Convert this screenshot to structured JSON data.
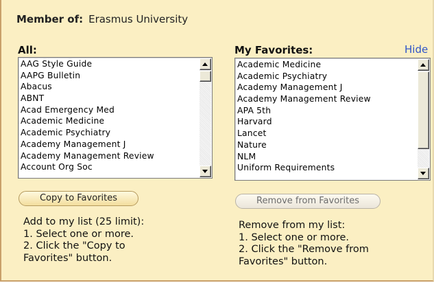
{
  "member": {
    "label": "Member of:",
    "value": "Erasmus University"
  },
  "all": {
    "title": "All:",
    "items": [
      "AAG Style Guide",
      "AAPG Bulletin",
      "Abacus",
      "ABNT",
      "Acad Emergency Med",
      "Academic Medicine",
      "Academic Psychiatry",
      "Academy Management J",
      "Academy Management Review",
      "Account Org Soc"
    ]
  },
  "favorites": {
    "title": "My Favorites:",
    "hide_label": "Hide",
    "items": [
      "Academic Medicine",
      "Academic Psychiatry",
      "Academy Management J",
      "Academy Management Review",
      "APA 5th",
      "Harvard",
      "Lancet",
      "Nature",
      "NLM",
      "Uniform Requirements"
    ]
  },
  "buttons": {
    "copy": "Copy to Favorites",
    "remove": "Remove from Favorites"
  },
  "instructions_add": [
    "Add to my list (25 limit):",
    "1. Select one or more.",
    "2. Click the \"Copy to",
    "Favorites\" button."
  ],
  "instructions_remove": [
    "Remove from my list:",
    "1. Select one or more.",
    "2. Click the \"Remove from",
    "Favorites\" button."
  ]
}
